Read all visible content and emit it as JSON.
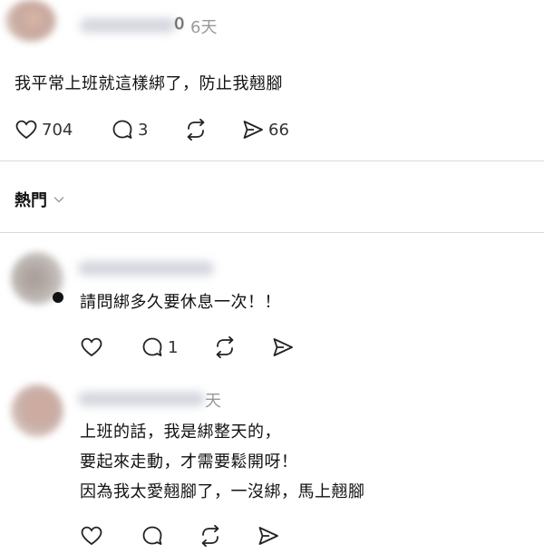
{
  "post": {
    "time": "6天",
    "text": "我平常上班就這樣綁了，防止我翹腳",
    "likes": "704",
    "comments": "3",
    "shares": "66"
  },
  "sort": {
    "label": "熱門"
  },
  "replies": [
    {
      "text": "請問綁多久要休息一次！！",
      "comments": "1"
    },
    {
      "time_suffix": "天",
      "lines": [
        "上班的話，我是綁整天的，",
        "要起來走動，才需要鬆開呀！",
        "因為我太愛翹腳了，一沒綁，馬上翹腳"
      ]
    }
  ]
}
